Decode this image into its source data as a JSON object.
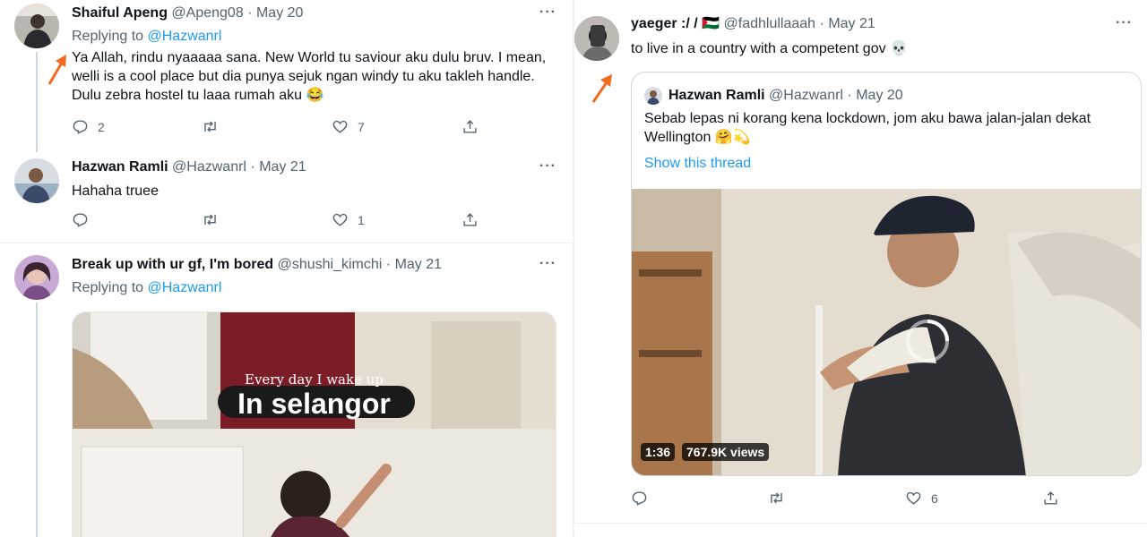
{
  "left": {
    "tweets": [
      {
        "name": "Shaiful Apeng",
        "handle": "@Apeng08",
        "date": "May 20",
        "replying_label": "Replying to",
        "replying_handle": "@Hazwanrl",
        "text": "Ya Allah, rindu nyaaaaa sana. New World tu saviour aku dulu bruv. I mean, welli is a cool place but dia punya sejuk ngan windy tu aku takleh handle. Dulu zebra hostel tu laaa rumah aku 😂",
        "reply_count": "2",
        "retweet_count": "",
        "like_count": "7"
      },
      {
        "name": "Hazwan Ramli",
        "handle": "@Hazwanrl",
        "date": "May 21",
        "text": "Hahaha truee",
        "reply_count": "",
        "retweet_count": "",
        "like_count": "1"
      },
      {
        "name": "Break up with ur gf, I'm bored",
        "handle": "@shushi_kimchi",
        "date": "May 21",
        "replying_label": "Replying to",
        "replying_handle": "@Hazwanrl",
        "media_caption_small": "Every day I wake up",
        "media_caption_big": "In selangor"
      }
    ]
  },
  "right": {
    "tweet": {
      "name": "yaeger :/ /",
      "flag": "🇵🇸",
      "handle": "@fadhlullaaah",
      "date": "May 21",
      "text": "to live in a country with a competent gov 💀",
      "reply_count": "",
      "retweet_count": "",
      "like_count": "6"
    },
    "quote": {
      "name": "Hazwan Ramli",
      "handle": "@Hazwanrl",
      "date": "May 20",
      "text": "Sebab lepas ni korang kena lockdown, jom aku bawa jalan-jalan dekat Wellington 🤗💫",
      "show_thread": "Show this thread",
      "video_duration": "1:36",
      "video_views": "767.9K views"
    }
  },
  "separator": "·",
  "colors": {
    "link": "#1d9bf0",
    "muted": "#536471",
    "arrow": "#f26b21"
  },
  "icons": [
    "reply-icon",
    "retweet-icon",
    "like-icon",
    "share-icon",
    "more-icon",
    "arrow-icon"
  ]
}
